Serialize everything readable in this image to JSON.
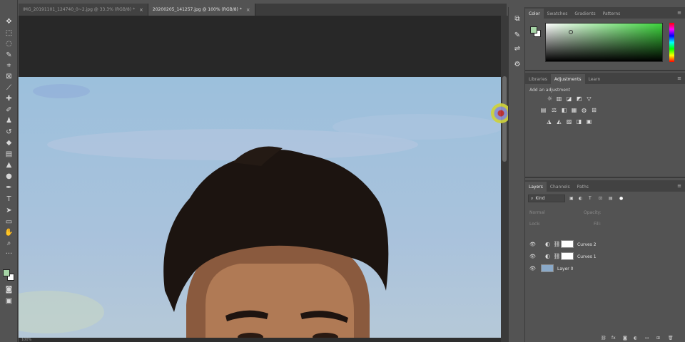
{
  "tabs": [
    {
      "label": "IMG_20191101_124740_0~2.jpg @ 33.3% (RGB/8) *",
      "close": "×"
    },
    {
      "label": "20200205_141257.jpg @ 100% (RGB/8) *",
      "close": "×"
    }
  ],
  "color_panel": {
    "tabs": [
      "Color",
      "Swatches",
      "Gradients",
      "Patterns"
    ],
    "foreground": "#a6d4a6",
    "background": "#ffffff"
  },
  "adjustments_panel": {
    "tabs": [
      "Libraries",
      "Adjustments",
      "Learn"
    ],
    "add_label": "Add an adjustment"
  },
  "layers_panel": {
    "tabs": [
      "Layers",
      "Channels",
      "Paths"
    ],
    "kind_filter": "Kind",
    "blend_mode": "Normal",
    "opacity_label": "Opacity:",
    "lock_label": "Lock:",
    "fill_label": "Fill:",
    "layers": [
      {
        "name": "Curves 2"
      },
      {
        "name": "Curves 1"
      },
      {
        "name": "Layer 0"
      }
    ]
  },
  "status": {
    "zoom": "100%"
  },
  "icons": {
    "tools": [
      "move-icon",
      "marquee-icon",
      "lasso-icon",
      "quick-select-icon",
      "crop-icon",
      "frame-icon",
      "eyedropper-icon",
      "healing-icon",
      "brush-icon",
      "clone-stamp-icon",
      "history-brush-icon",
      "eraser-icon",
      "gradient-icon",
      "blur-icon",
      "dodge-icon",
      "pen-icon",
      "type-icon",
      "path-select-icon",
      "rectangle-icon",
      "hand-icon",
      "zoom-icon",
      "more-tools-icon"
    ],
    "strip": [
      "history-icon",
      "brush-settings-icon",
      "properties-icon",
      "adjust-icon"
    ]
  },
  "menu_glyph": "≡"
}
